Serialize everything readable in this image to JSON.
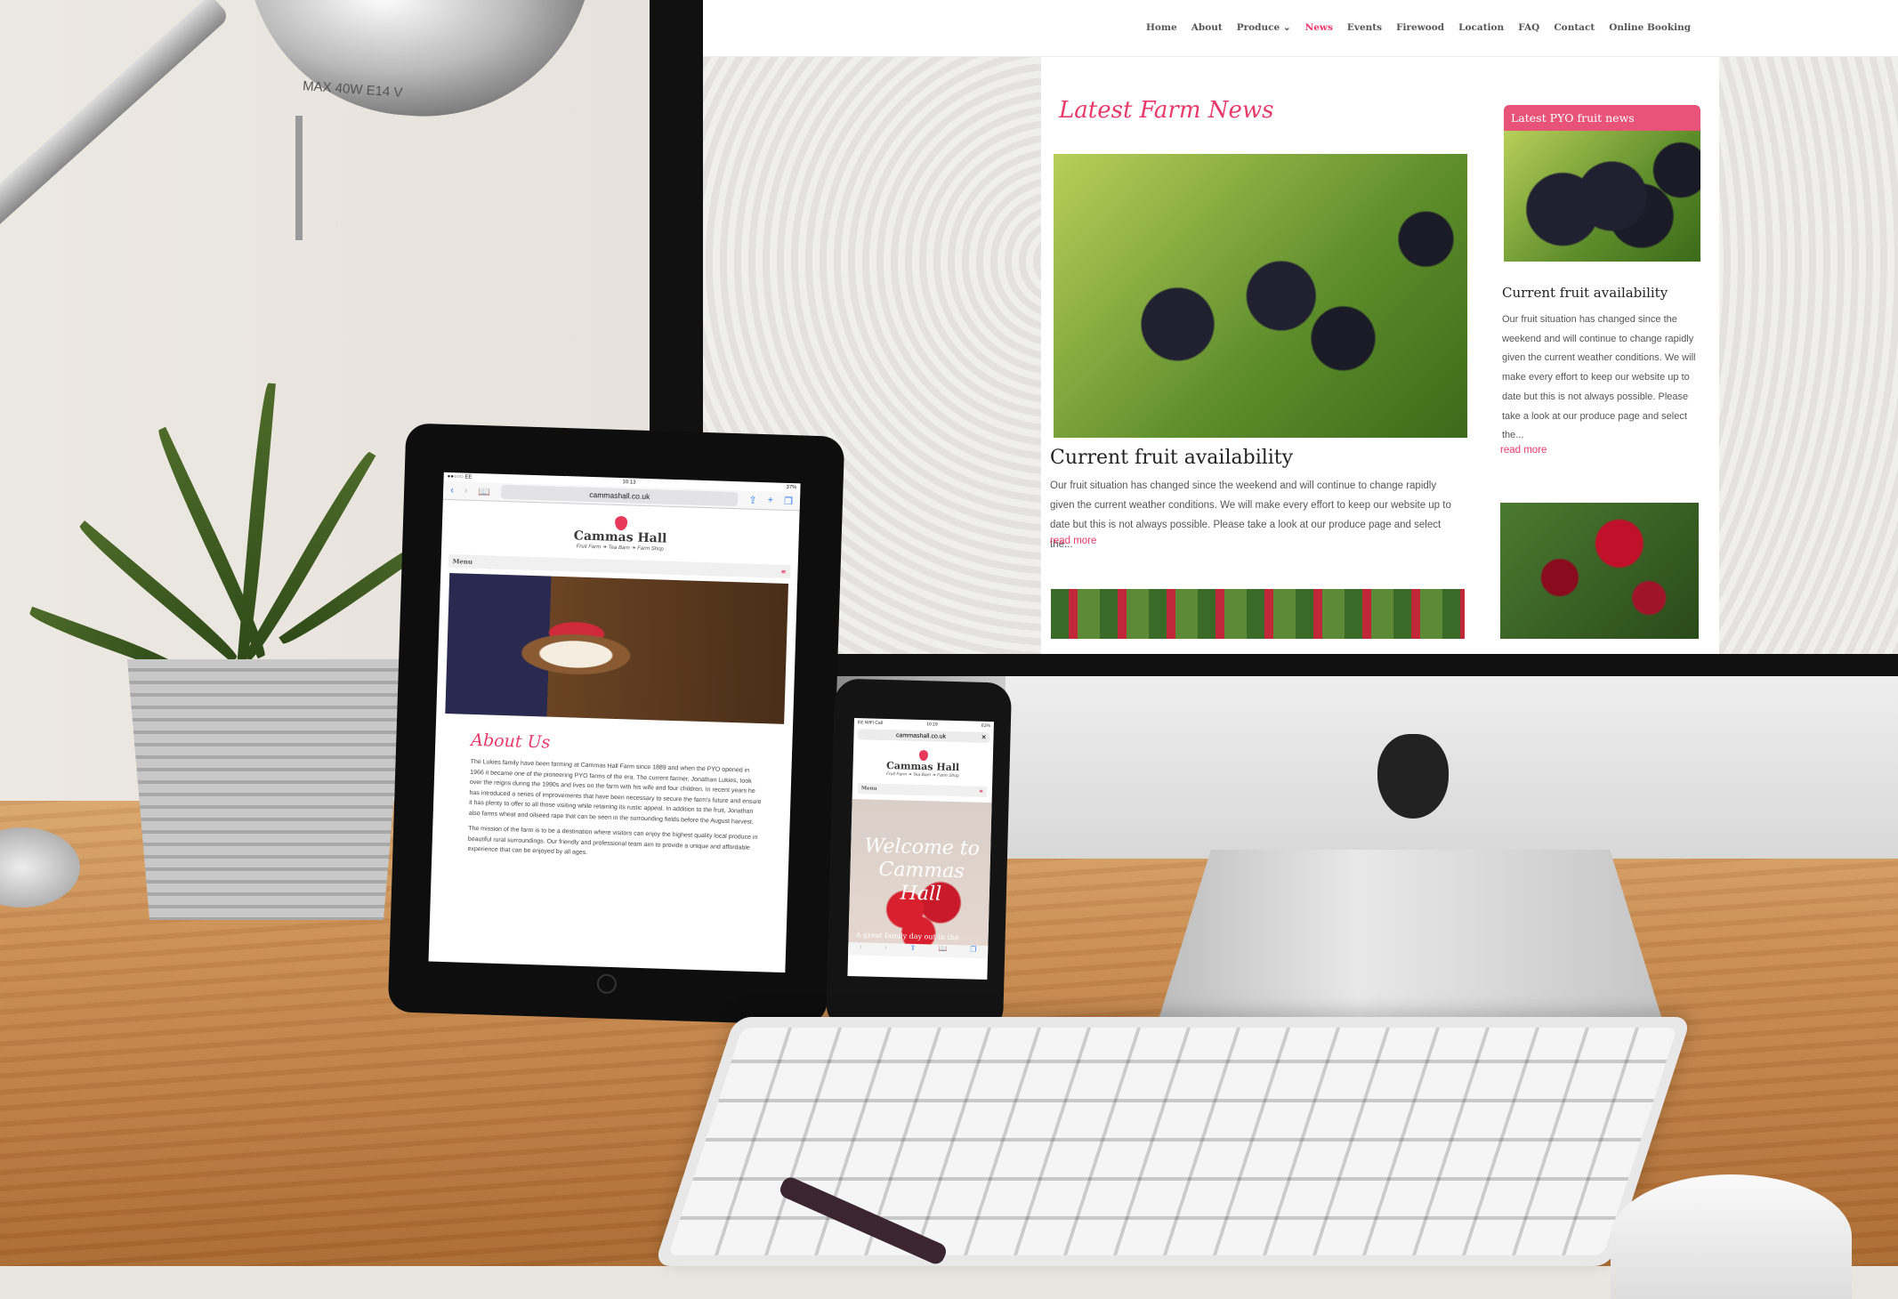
{
  "lamp": {
    "label": "MAX 40W E14 V"
  },
  "website": {
    "nav": [
      "Home",
      "About",
      "Produce",
      "News",
      "Events",
      "Firewood",
      "Location",
      "FAQ",
      "Contact",
      "Online Booking"
    ],
    "nav_active": "News",
    "news_heading": "Latest Farm News",
    "post": {
      "title": "Current fruit availability",
      "excerpt": "Our fruit situation has changed since the weekend and will continue to change rapidly given the current weather conditions. We will make every effort to keep our website up to date but this is not always possible. Please take a look at our produce page and select the...",
      "read_more": "read more"
    },
    "sidebar": {
      "heading": "Latest PYO fruit news",
      "title": "Current fruit availability",
      "excerpt": "Our fruit situation has changed since the weekend and will continue to change rapidly given the current weather conditions. We will make every effort to keep our website up to date but this is not always possible. Please take a look at our produce page and select the...",
      "read_more": "read more"
    },
    "accent": "#e8396a"
  },
  "tablet": {
    "status": {
      "carrier": "●●○○○ EE",
      "time": "10:13",
      "battery": "37%"
    },
    "url": "cammashall.co.uk",
    "logo_title": "Cammas Hall",
    "logo_sub": "Fruit Farm ❧ Tea Barn ❧ Farm Shop",
    "menu": "Menu",
    "about_heading": "About Us",
    "about_p1": "The Lukies family have been farming at Cammas Hall Farm since 1889 and when the PYO opened in 1966 it became one of the pioneering PYO farms of the era. The current farmer, Jonathan Lukies, took over the reigns during the 1990s and lives on the farm with his wife and four children. In recent years he has introduced a series of improvements that have been necessary to secure the farm's future and ensure it has plenty to offer to all those visiting while retaining its rustic appeal. In addition to the fruit, Jonathan also farms wheat and oilseed rape that can be seen in the surrounding fields before the August harvest.",
    "about_p2": "The mission of the farm is to be a destination where visitors can enjoy the highest quality local produce in beautiful rural surroundings. Our friendly and professional team aim to provide a unique and affordable experience that can be enjoyed by all ages."
  },
  "phone": {
    "status": {
      "carrier": "EE WiFi Call",
      "time": "10:19",
      "battery": "61%"
    },
    "url": "cammashall.co.uk",
    "logo_title": "Cammas Hall",
    "logo_sub": "Fruit Farm ❧ Tea Barn ❧ Farm Shop",
    "menu": "Menu",
    "welcome": "Welcome to Cammas Hall",
    "subtitle": "A great family day out in the"
  }
}
